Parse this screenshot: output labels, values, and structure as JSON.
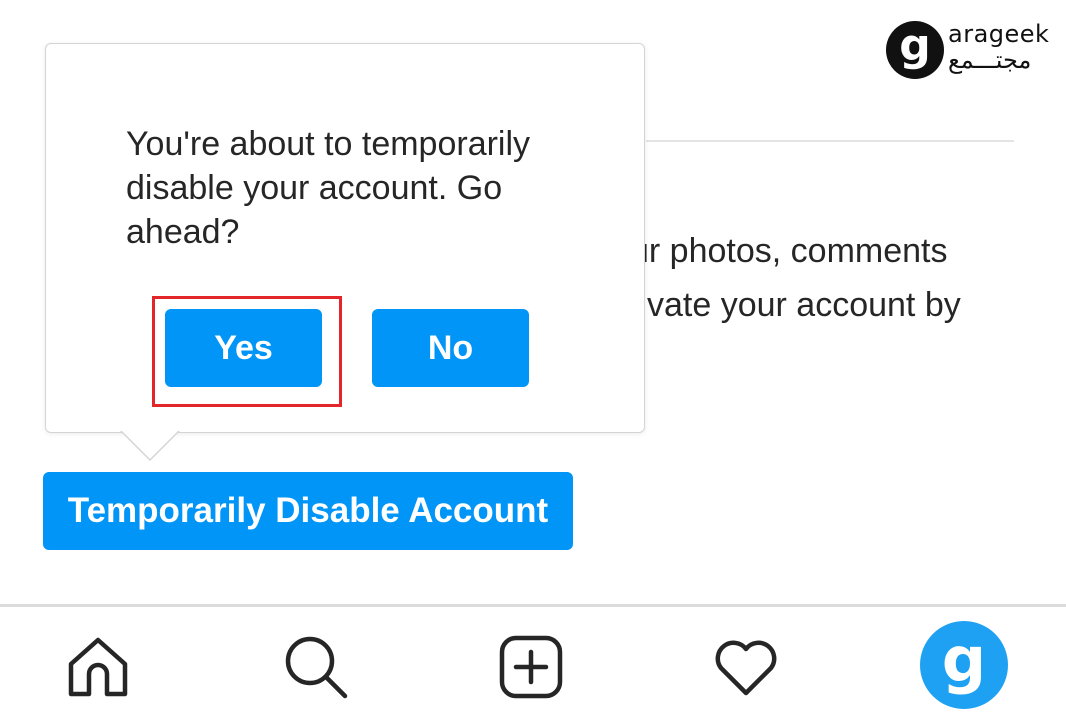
{
  "watermark": {
    "logo_glyph": "g",
    "latin": "arageek",
    "arabic": "مجتـــمع"
  },
  "background_text": {
    "line1": "ur photos, comments",
    "line2": "tivate your account by"
  },
  "confirm_dialog": {
    "message": "You're about to temporarily disable your account. Go ahead?",
    "yes_label": "Yes",
    "no_label": "No"
  },
  "primary_action": {
    "label": "Temporarily Disable Account"
  },
  "bottom_nav": {
    "items": [
      {
        "icon": "home-icon"
      },
      {
        "icon": "search-icon"
      },
      {
        "icon": "new-post-icon"
      },
      {
        "icon": "heart-icon"
      },
      {
        "icon": "avatar",
        "glyph": "g"
      }
    ]
  },
  "colors": {
    "accent": "#0095f6",
    "highlight": "#e3262a",
    "avatar_bg": "#1ea1f2",
    "text": "#262626"
  }
}
